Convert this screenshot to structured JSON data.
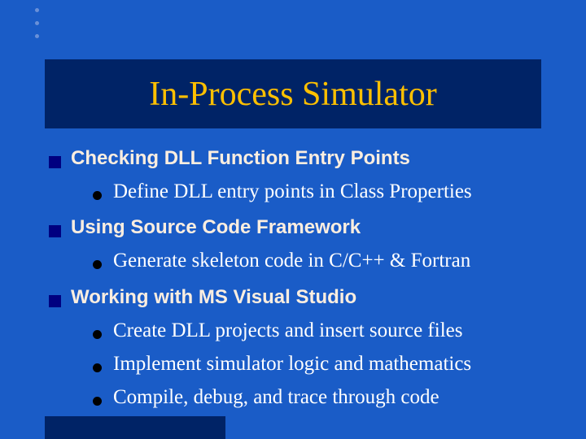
{
  "title": "In-Process Simulator",
  "bullets": {
    "b1": "Checking DLL Function Entry Points",
    "b1_1": "Define DLL entry points in Class Properties",
    "b2": "Using Source Code Framework",
    "b2_1": "Generate skeleton code in C/C++ & Fortran",
    "b3": "Working with MS Visual Studio",
    "b3_1": "Create DLL projects and insert source files",
    "b3_2": "Implement simulator logic and mathematics",
    "b3_3": "Compile, debug, and trace through code"
  }
}
